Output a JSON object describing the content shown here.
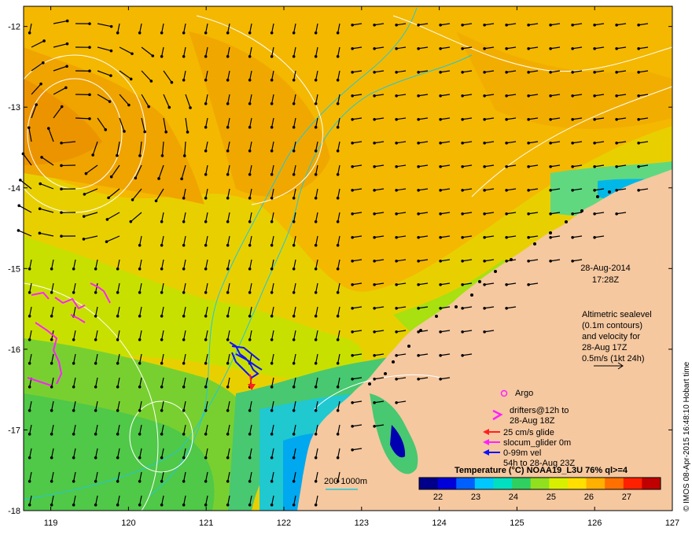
{
  "map": {
    "lat_ticks": [
      "-12",
      "-13",
      "-14",
      "-15",
      "-16",
      "-17",
      "-18"
    ],
    "lon_ticks": [
      "119",
      "120",
      "121",
      "122",
      "123",
      "124",
      "125",
      "126",
      "127"
    ],
    "lat_values": [
      -12,
      -13,
      -14,
      -15,
      -16,
      -17,
      -18
    ],
    "lon_values": [
      119,
      120,
      121,
      122,
      123,
      124,
      125,
      126,
      127
    ],
    "lon_range": [
      118.65,
      127.0
    ],
    "lat_range": [
      -11.75,
      -18.0
    ]
  },
  "datestamp": {
    "date": "28-Aug-2014",
    "time": "17:28Z"
  },
  "altimetry": {
    "line1": "Altimetric sealevel",
    "line2": "(0.1m contours)",
    "line3": "and velocity for",
    "line4": "28-Aug 17Z",
    "line5": "0.5m/s (1kt 24h)"
  },
  "legend": {
    "argo": "Argo",
    "drifters_line1": "drifters@12h to",
    "drifters_line2": "28-Aug 18Z",
    "glide": "25 cm/s glide",
    "slocum": "slocum_glider 0m",
    "vel_line1": "0-99m vel",
    "vel_line2": "54h to 28-Aug 23Z",
    "isobath": "200  1000m"
  },
  "colorbar": {
    "title": "Temperature (°C) NOAA19_L3U 76% ql>=4",
    "ticks": [
      "22",
      "23",
      "24",
      "25",
      "26",
      "27"
    ],
    "range": [
      21.5,
      27.9
    ],
    "colors": [
      "#00008b",
      "#0000d8",
      "#0060ff",
      "#00c8ff",
      "#00e0c0",
      "#30d060",
      "#90e020",
      "#d8f000",
      "#ffe000",
      "#ffb000",
      "#ff7000",
      "#ff2000",
      "#c00000"
    ]
  },
  "credit": "© IMOS 08-Apr-2015 16:48:10 Hobart time",
  "colors": {
    "land": "#f5c8a0",
    "isobath": "#20c8d8",
    "sealevel_contour": "#ffffff",
    "arrow": "#000000",
    "drifter": "#ff20ff",
    "glide": "#ff2020",
    "vel": "#1010ff"
  }
}
